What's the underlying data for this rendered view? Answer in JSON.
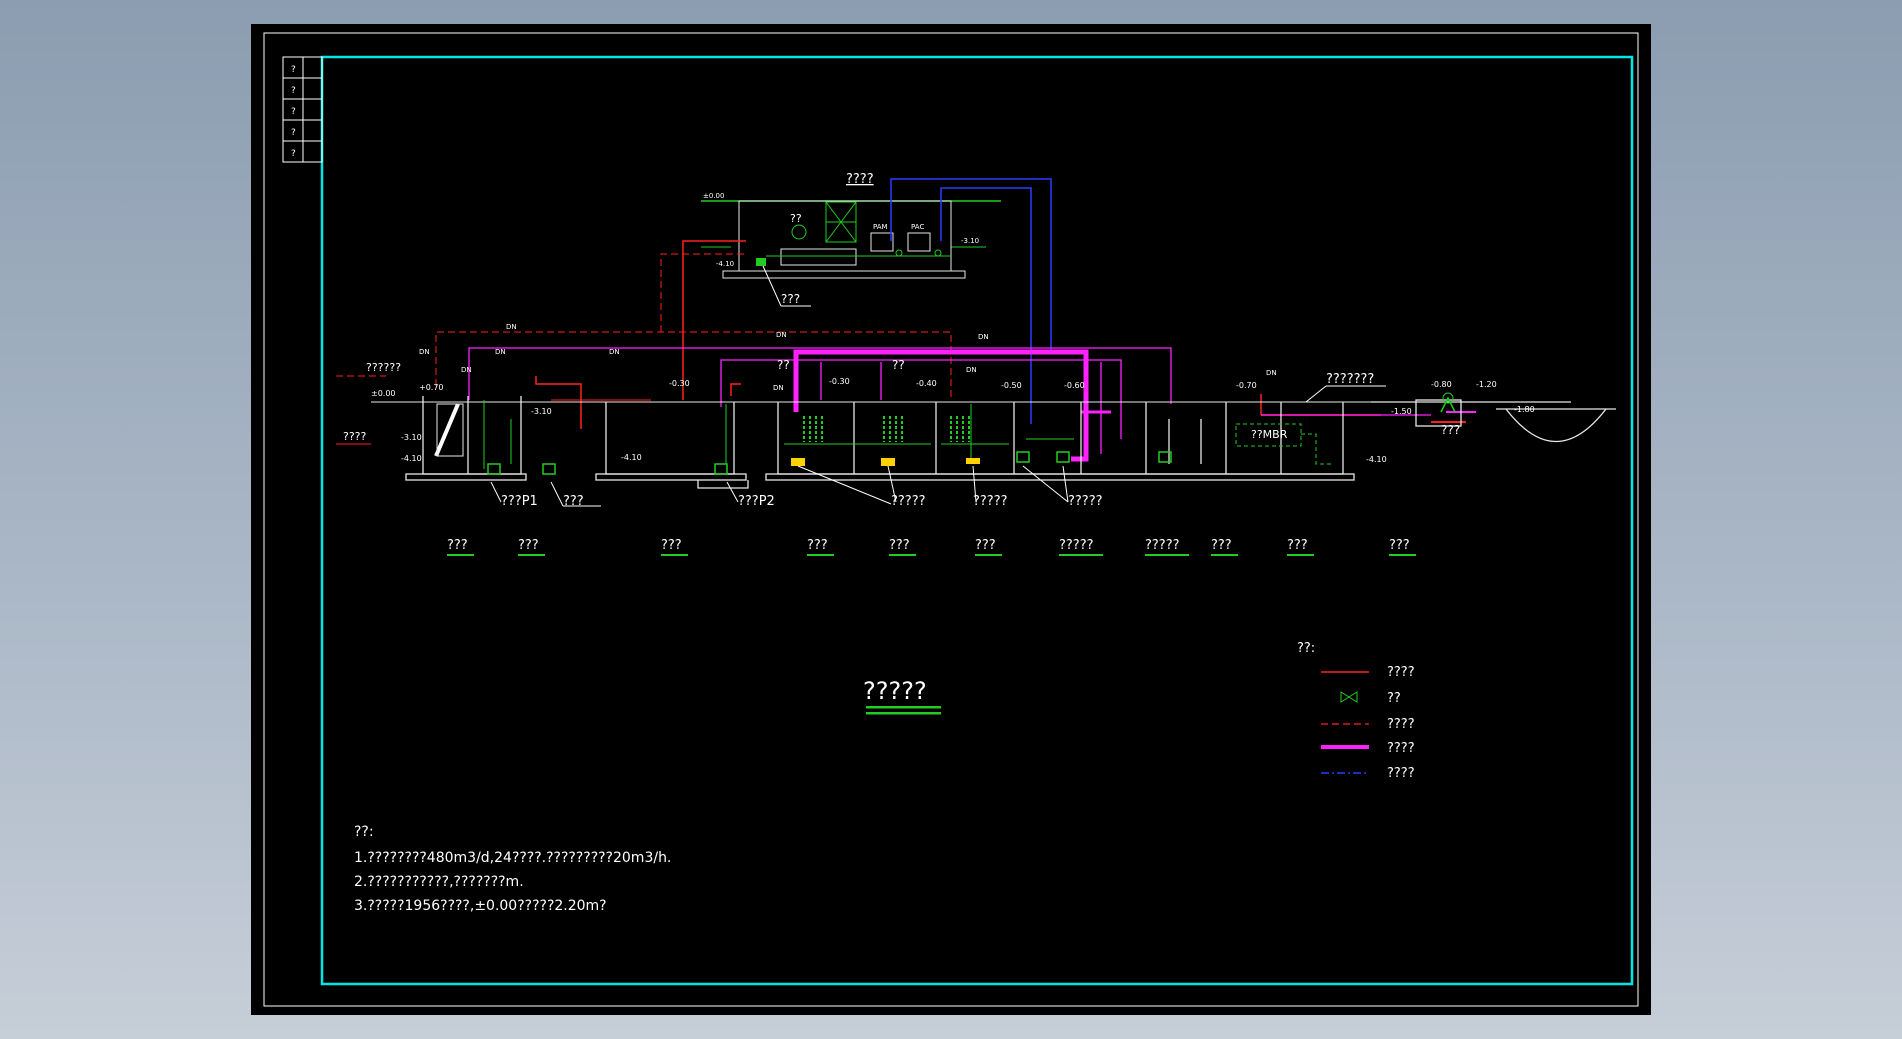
{
  "colors": {
    "background_outer": "#9aa9bb",
    "sheet": "#000000",
    "frame_white": "#ffffff",
    "frame_cyan": "#00e5e5",
    "sludge_pipe_red": "#ff2020",
    "aeration_pipe_magenta": "#ff22ff",
    "water_line_blue": "#2a3cff",
    "equipment_green": "#22cc22",
    "tank_white": "#e8e8e8",
    "text": "#ffffff",
    "label_yellow": "#ffd200"
  },
  "title_block": {
    "cells": [
      "?",
      "?",
      "?",
      "?",
      "?"
    ]
  },
  "equipment_room": {
    "title": "????",
    "blower_label": "??",
    "pam_label": "PAM",
    "pac_label": "PAC",
    "level_ground": "±0.00",
    "level_floor": "-3.10",
    "level_sump": "-4.10",
    "room_pump_label": "???"
  },
  "left_inlets": {
    "top_label": "??????",
    "inflow_label": "????"
  },
  "levels": {
    "grid_top": "±0.00",
    "grid_inner": "+0.70",
    "grille_low": "-3.10",
    "grille_bottom": "-4.10",
    "pump1_level": "-3.10",
    "adjust_level": "-0.30",
    "adjust_bottom": "-4.10",
    "anoxic1": "-0.30",
    "anoxic2": "-0.40",
    "aerobic": "-0.50",
    "settle": "-0.60",
    "mbr": "-0.70",
    "disinfect": "-1.50",
    "outfall_a": "-0.80",
    "outfall_b": "-1.20",
    "river": "-1.80",
    "bottom_right": "-4.10"
  },
  "pipe_tags": [
    "DN",
    "DN",
    "DN",
    "DN",
    "DN",
    "DN",
    "DN",
    "DN",
    "DN",
    "DN"
  ],
  "callouts": {
    "pump_p1": "???P1",
    "pump_a": "???",
    "pump_p2": "???P2",
    "aerator_a": "?????",
    "aerator_b": "?????",
    "aerator_c": "?????",
    "top_small": "??",
    "top_small_2": "??",
    "mbr": "??MBR",
    "top_right": "???????",
    "outfall": "???"
  },
  "unit_labels": [
    "???",
    "???",
    "???",
    "???",
    "???",
    "???",
    "?????",
    "?????",
    "???",
    "???",
    "???"
  ],
  "drawing_title": "?????",
  "legend": {
    "heading": "??:",
    "items": [
      {
        "label": "????",
        "style": "red-solid"
      },
      {
        "label": "??",
        "style": "valve"
      },
      {
        "label": "????",
        "style": "red-dashed"
      },
      {
        "label": "????",
        "style": "magenta-thick"
      },
      {
        "label": "????",
        "style": "blue-dashdot"
      }
    ]
  },
  "notes": {
    "heading": "??:",
    "lines": [
      "1.????????480m3/d,24????.?????????20m3/h.",
      "2.???????????,???????m.",
      "3.?????1956????,±0.00?????2.20m?"
    ]
  }
}
